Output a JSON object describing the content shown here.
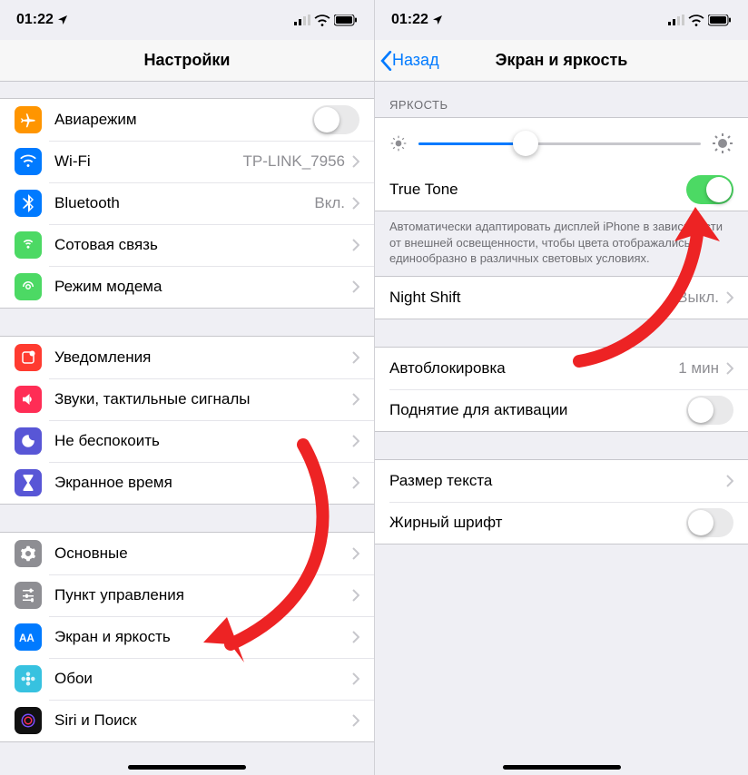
{
  "statusbar": {
    "time": "01:22",
    "location_icon": "◀",
    "signal": "▪▪",
    "wifi": "wifi",
    "battery": "battery"
  },
  "left": {
    "title": "Настройки",
    "groups": [
      {
        "rows": [
          {
            "icon": "airplane",
            "color": "#ff9500",
            "label": "Авиарежим",
            "control": "switch",
            "on": false
          },
          {
            "icon": "wifi",
            "color": "#007aff",
            "label": "Wi-Fi",
            "value": "TP-LINK_7956",
            "control": "chevron"
          },
          {
            "icon": "bluetooth",
            "color": "#007aff",
            "label": "Bluetooth",
            "value": "Вкл.",
            "control": "chevron"
          },
          {
            "icon": "cellular",
            "color": "#4cd964",
            "label": "Сотовая связь",
            "control": "chevron"
          },
          {
            "icon": "hotspot",
            "color": "#4cd964",
            "label": "Режим модема",
            "control": "chevron"
          }
        ]
      },
      {
        "rows": [
          {
            "icon": "notifications",
            "color": "#ff3b30",
            "label": "Уведомления",
            "control": "chevron"
          },
          {
            "icon": "sounds",
            "color": "#ff2d55",
            "label": "Звуки, тактильные сигналы",
            "control": "chevron"
          },
          {
            "icon": "dnd",
            "color": "#5856d6",
            "label": "Не беспокоить",
            "control": "chevron"
          },
          {
            "icon": "screentime",
            "color": "#5856d6",
            "label": "Экранное время",
            "control": "chevron"
          }
        ]
      },
      {
        "rows": [
          {
            "icon": "general",
            "color": "#8e8e93",
            "label": "Основные",
            "control": "chevron"
          },
          {
            "icon": "control-center",
            "color": "#8e8e93",
            "label": "Пункт управления",
            "control": "chevron"
          },
          {
            "icon": "display",
            "color": "#007aff",
            "label": "Экран и яркость",
            "control": "chevron"
          },
          {
            "icon": "wallpaper",
            "color": "#37c2e0",
            "label": "Обои",
            "control": "chevron"
          },
          {
            "icon": "siri",
            "color": "#111",
            "label": "Siri и Поиск",
            "control": "chevron"
          }
        ]
      }
    ]
  },
  "right": {
    "back": "Назад",
    "title": "Экран и яркость",
    "brightness": {
      "header": "ЯРКОСТЬ",
      "value_pct": 38
    },
    "truetone": {
      "label": "True Tone",
      "on": true,
      "footer": "Автоматически адаптировать дисплей iPhone в зависимости от внешней освещенности, чтобы цвета отображались единообразно в различных световых условиях."
    },
    "nightshift": {
      "label": "Night Shift",
      "value": "Выкл."
    },
    "autolock": {
      "label": "Автоблокировка",
      "value": "1 мин"
    },
    "raise": {
      "label": "Поднятие для активации",
      "on": false
    },
    "textsize": {
      "label": "Размер текста"
    },
    "bold": {
      "label": "Жирный шрифт",
      "on": false
    }
  },
  "annotations": {
    "arrow_color": "#ed2324"
  }
}
